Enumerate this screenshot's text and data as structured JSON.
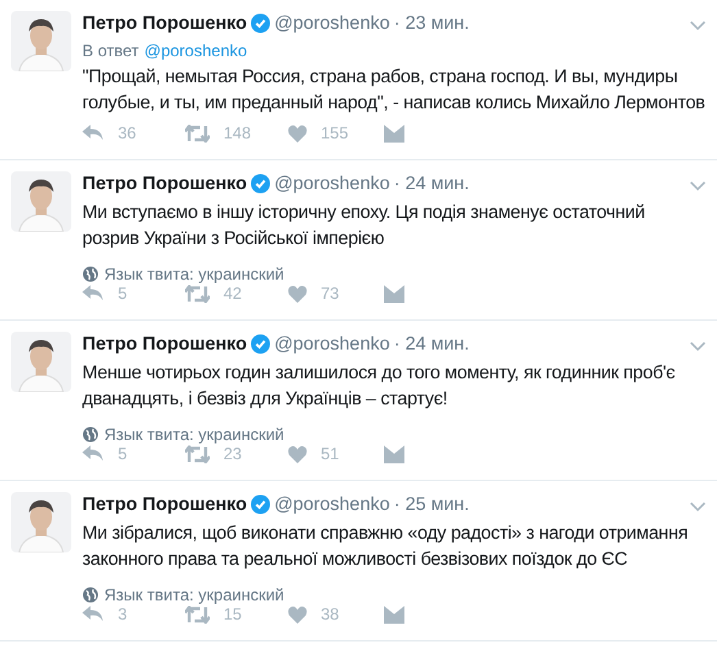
{
  "tweets": [
    {
      "name": "Петро Порошенко",
      "verified": true,
      "handle": "@poroshenko",
      "time": "· 23 мин.",
      "reply_prefix": "В ответ",
      "reply_to": "@poroshenko",
      "text": "\"Прощай, немытая Россия, страна рабов, страна господ. И вы, мундиры голубые, и ты, им преданный народ\", - написав колись Михайло Лермонтов",
      "replies": "36",
      "retweets": "148",
      "likes": "155"
    },
    {
      "name": "Петро Порошенко",
      "verified": true,
      "handle": "@poroshenko",
      "time": "· 24 мин.",
      "text": "Ми вступаємо в іншу історичну епоху. Ця подія знаменує остаточний розрив України з Російської імперією",
      "language": "Язык твита: украинский",
      "replies": "5",
      "retweets": "42",
      "likes": "73"
    },
    {
      "name": "Петро Порошенко",
      "verified": true,
      "handle": "@poroshenko",
      "time": "· 24 мин.",
      "text": "Менше чотирьох годин залишилося до того моменту, як годинник проб'є дванадцять, і безвіз для Українців – стартує!",
      "language": "Язык твита: украинский",
      "replies": "5",
      "retweets": "23",
      "likes": "51"
    },
    {
      "name": "Петро Порошенко",
      "verified": true,
      "handle": "@poroshenko",
      "time": "· 25 мин.",
      "text": "Ми зібралися, щоб виконати справжню «оду радості» з нагоди отримання законного права та реальної можливості безвізових поїздок до ЄС",
      "language": "Язык твита: украинский",
      "replies": "3",
      "retweets": "15",
      "likes": "38"
    }
  ]
}
